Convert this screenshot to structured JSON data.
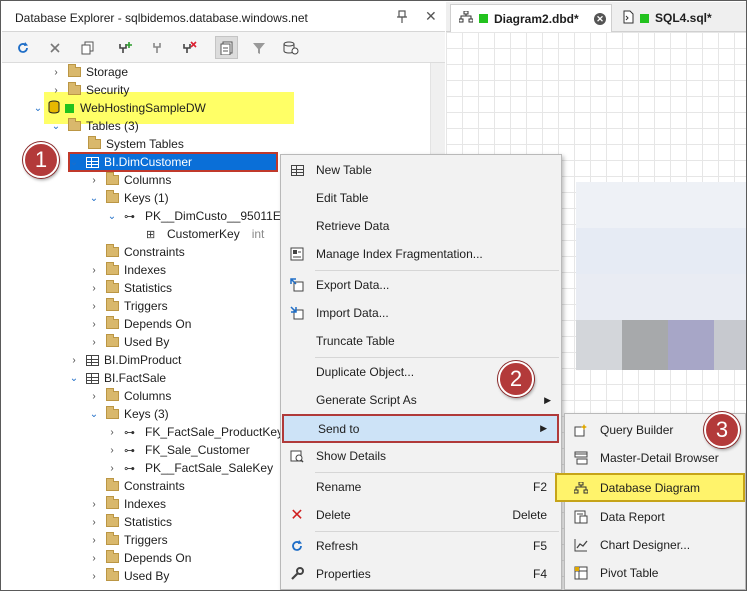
{
  "explorer": {
    "title": "Database Explorer - sqlbidemos.database.windows.net"
  },
  "tree": [
    {
      "label": "Storage",
      "kind": "folder",
      "depth": 0
    },
    {
      "label": "Security",
      "kind": "folder",
      "depth": 0
    },
    {
      "label": "WebHostingSampleDW",
      "kind": "database",
      "depth": -1
    },
    {
      "label": "Tables (3)",
      "kind": "folder",
      "depth": 0
    },
    {
      "label": "System Tables",
      "kind": "folder",
      "depth": 1
    },
    {
      "label": "BI.DimCustomer",
      "kind": "table",
      "depth": 1
    },
    {
      "label": "Columns",
      "kind": "folder",
      "depth": 2
    },
    {
      "label": "Keys (1)",
      "kind": "folder",
      "depth": 2
    },
    {
      "label": "PK__DimCusto__95011E",
      "kind": "pk",
      "depth": 3
    },
    {
      "label": "CustomerKey",
      "kind": "column",
      "depth": 4,
      "type": "int"
    },
    {
      "label": "Constraints",
      "kind": "folder",
      "depth": 2
    },
    {
      "label": "Indexes",
      "kind": "folder",
      "depth": 2
    },
    {
      "label": "Statistics",
      "kind": "folder",
      "depth": 2
    },
    {
      "label": "Triggers",
      "kind": "folder",
      "depth": 2
    },
    {
      "label": "Depends On",
      "kind": "folder",
      "depth": 2
    },
    {
      "label": "Used By",
      "kind": "folder",
      "depth": 2
    },
    {
      "label": "BI.DimProduct",
      "kind": "table",
      "depth": 1
    },
    {
      "label": "BI.FactSale",
      "kind": "table",
      "depth": 1
    },
    {
      "label": "Columns",
      "kind": "folder",
      "depth": 2
    },
    {
      "label": "Keys (3)",
      "kind": "folder",
      "depth": 2
    },
    {
      "label": "FK_FactSale_ProductKey",
      "kind": "fk",
      "depth": 3
    },
    {
      "label": "FK_Sale_Customer",
      "kind": "fk",
      "depth": 3
    },
    {
      "label": "PK__FactSale_SaleKey",
      "kind": "pk",
      "depth": 3
    },
    {
      "label": "Constraints",
      "kind": "folder",
      "depth": 2
    },
    {
      "label": "Indexes",
      "kind": "folder",
      "depth": 2
    },
    {
      "label": "Statistics",
      "kind": "folder",
      "depth": 2
    },
    {
      "label": "Triggers",
      "kind": "folder",
      "depth": 2
    },
    {
      "label": "Depends On",
      "kind": "folder",
      "depth": 2
    },
    {
      "label": "Used By",
      "kind": "folder",
      "depth": 2
    }
  ],
  "tabs": [
    {
      "label": "Diagram2.dbd*"
    },
    {
      "label": "SQL4.sql*"
    }
  ],
  "context_menu": [
    {
      "label": "New Table",
      "shortcut": "",
      "icon": "table-icon"
    },
    {
      "label": "Edit Table",
      "shortcut": "",
      "icon": ""
    },
    {
      "label": "Retrieve Data",
      "shortcut": "",
      "icon": ""
    },
    {
      "label": "Manage Index Fragmentation...",
      "shortcut": "",
      "icon": "index-icon"
    },
    {
      "label": "Export Data...",
      "shortcut": "",
      "icon": "export-icon"
    },
    {
      "label": "Import Data...",
      "shortcut": "",
      "icon": "import-icon"
    },
    {
      "label": "Truncate Table",
      "shortcut": "",
      "icon": ""
    },
    {
      "label": "Duplicate Object...",
      "shortcut": "",
      "icon": ""
    },
    {
      "label": "Generate Script As",
      "shortcut": "",
      "icon": ""
    },
    {
      "label": "Send to",
      "shortcut": "",
      "icon": ""
    },
    {
      "label": "Show Details",
      "shortcut": "",
      "icon": "details-icon"
    },
    {
      "label": "Rename",
      "shortcut": "F2",
      "icon": ""
    },
    {
      "label": "Delete",
      "shortcut": "Delete",
      "icon": "delete-icon"
    },
    {
      "label": "Refresh",
      "shortcut": "F5",
      "icon": "refresh-icon"
    },
    {
      "label": "Properties",
      "shortcut": "F4",
      "icon": "wrench-icon"
    }
  ],
  "send_to_submenu": [
    {
      "label": "Query Builder",
      "icon": "query-builder-icon"
    },
    {
      "label": "Master-Detail Browser",
      "icon": "master-detail-icon"
    },
    {
      "label": "Database Diagram",
      "icon": "diagram-icon"
    },
    {
      "label": "Data Report",
      "icon": "report-icon"
    },
    {
      "label": "Chart Designer...",
      "icon": "chart-icon"
    },
    {
      "label": "Pivot Table",
      "icon": "pivot-icon"
    }
  ],
  "badges": [
    "1",
    "2",
    "3"
  ],
  "colors": {
    "selection": "#0a6fd8",
    "highlight_yellow": "#ffff66",
    "badge_red": "#b33a3a",
    "menu_hover": "#cde3f7",
    "green_status": "#22c21e"
  }
}
